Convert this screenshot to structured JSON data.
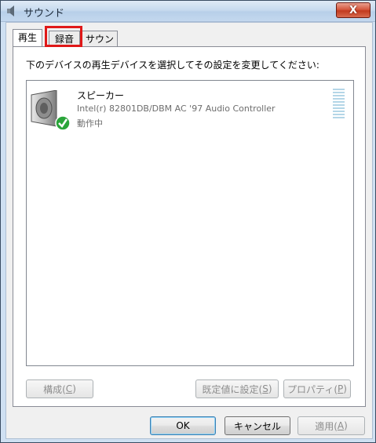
{
  "window": {
    "title": "サウンド",
    "close_glyph": "X"
  },
  "tabs": [
    {
      "label": "再生",
      "active": true
    },
    {
      "label": "録音",
      "active": false
    },
    {
      "label": "サウンド",
      "active": false
    }
  ],
  "instruction": "下のデバイスの再生デバイスを選択してその設定を変更してください:",
  "devices": [
    {
      "name": "スピーカー",
      "description": "Intel(r) 82801DB/DBM AC '97 Audio Controller",
      "status": "動作中"
    }
  ],
  "panel_buttons": {
    "configure_label": "構成(",
    "configure_key": "C",
    "configure_end": ")",
    "set_default_label": "既定値に設定(",
    "set_default_key": "S",
    "set_default_end": ")",
    "properties_label": "プロパティ(",
    "properties_key": "P",
    "properties_end": ")"
  },
  "dialog_buttons": {
    "ok": "OK",
    "cancel": "キャンセル",
    "apply_label": "適用(",
    "apply_key": "A",
    "apply_end": ")"
  },
  "colors": {
    "accent_highlight": "#e01818",
    "check_green": "#2aa53a"
  }
}
